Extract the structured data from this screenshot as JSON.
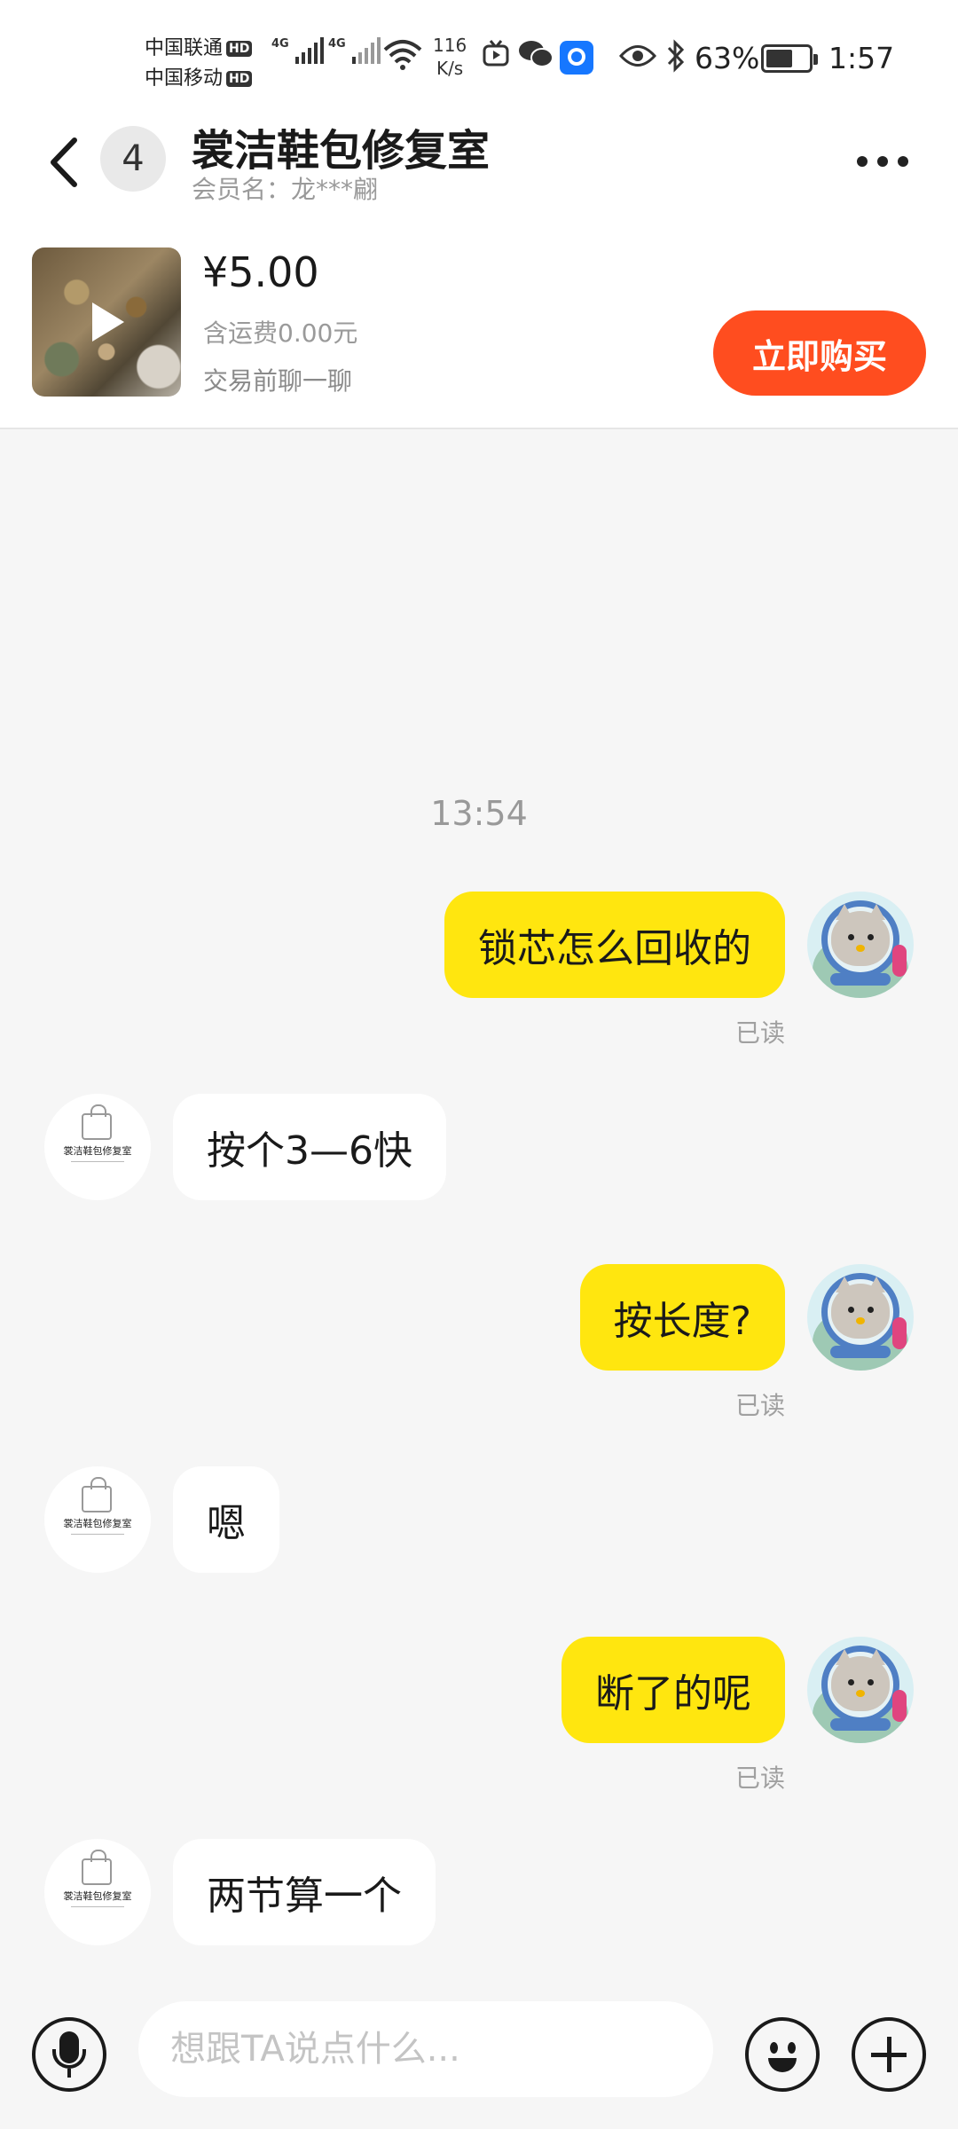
{
  "status_bar": {
    "carrier_1": "中国联通",
    "carrier_2": "中国移动",
    "hd_label": "HD",
    "network_type": "4G",
    "net_speed_value": "116",
    "net_speed_unit": "K/s",
    "battery_percent": "63%",
    "battery_level": 0.63,
    "time": "1:57"
  },
  "header": {
    "unread_count": "4",
    "title": "裳洁鞋包修复室",
    "member_label": "会员名：龙***翩"
  },
  "product": {
    "price": "¥5.00",
    "shipping": "含运费0.00元",
    "hint": "交易前聊一聊",
    "buy_label": "立即购买"
  },
  "chat": {
    "timestamp": "13:54",
    "read_label": "已读",
    "shop_avatar_text": "裳洁鞋包修复室",
    "messages": [
      {
        "from": "me",
        "text": "锁芯怎么回收的"
      },
      {
        "from": "them",
        "text": "按个3—6快"
      },
      {
        "from": "me",
        "text": "按长度?"
      },
      {
        "from": "them",
        "text": "嗯"
      },
      {
        "from": "me",
        "text": "断了的呢"
      },
      {
        "from": "them",
        "text": "两节算一个"
      }
    ]
  },
  "input_bar": {
    "placeholder": "想跟TA说点什么..."
  },
  "colors": {
    "my_bubble": "#ffe60f",
    "their_bubble": "#ffffff",
    "buy_button": "#ff4d1f",
    "background": "#f6f6f6"
  },
  "icons": {
    "back": "chevron-left-icon",
    "more": "more-dots-icon",
    "play": "play-icon",
    "voice": "microphone-icon",
    "emoji": "emoji-icon",
    "plus": "plus-icon"
  }
}
